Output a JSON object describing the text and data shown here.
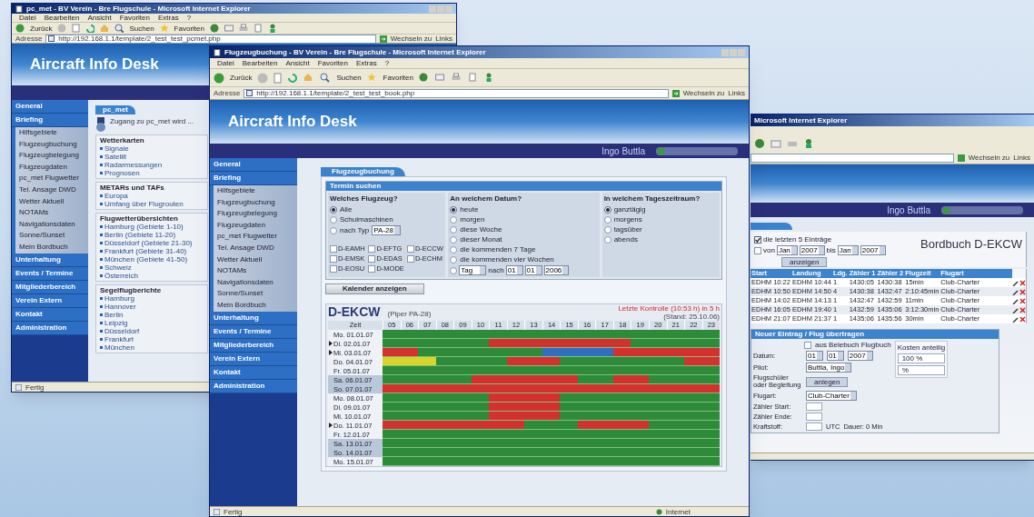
{
  "windows": [
    {
      "kind": "pcmet",
      "title": "pc_met - BV Verein - Bre Flugschule - Microsoft Internet Explorer",
      "menu": [
        "Datei",
        "Bearbeiten",
        "Ansicht",
        "Favoriten",
        "Extras",
        "?"
      ],
      "toolbar": [
        "Zurück",
        "Suchen",
        "Favoriten"
      ],
      "address_label": "Adresse",
      "url": "http://192.168.1.1/template/2_test_test_pcmet.php",
      "go_label": "Wechseln zu",
      "links_label": "Links",
      "site_title": "Aircraft Info Desk",
      "sidebar": [
        {
          "label": "General"
        },
        {
          "label": "Briefing",
          "children": [
            "Hilfsgebiete",
            "Flugzeugbuchung",
            "Flugzeugbelegung",
            "Flugzeugdaten",
            "pc_met Flugwetter",
            "Tel. Ansage DWD",
            "Wetter Aktuell",
            "NOTAMs",
            "Navigationsdaten",
            "Sonne/Sunset",
            "Mein Bordbuch"
          ]
        },
        {
          "label": "Unterhaltung"
        },
        {
          "label": "Events / Termine"
        },
        {
          "label": "Mitgliederbereich"
        },
        {
          "label": "Verein Extern"
        },
        {
          "label": "Kontakt"
        },
        {
          "label": "Administration"
        }
      ],
      "tab": "pc_met",
      "intro": "Zugang zu pc_met wird ...",
      "boxes": [
        {
          "title": "Wetterkarten",
          "items": [
            "Signale",
            "Satellit",
            "Radarmessungen",
            "Prognosen"
          ]
        },
        {
          "title": "METARs und TAFs",
          "items": [
            "Europa",
            "Umfang über Flugrouten"
          ]
        },
        {
          "title": "Flugwetterübersichten",
          "items": [
            "Hamburg (Gebiete 1-10)",
            "Berlin (Gebiete 11-20)",
            "Düsseldorf (Gebiete 21-30)",
            "Frankfurt (Gebiete 31-40)",
            "München (Gebiete 41-50)",
            "Schweiz",
            "Österreich"
          ]
        },
        {
          "title": "Segelflugberichte",
          "items": [
            "Hamburg",
            "Hannover",
            "Berlin",
            "Leipzig",
            "Düsseldorf",
            "Frankfurt",
            "München"
          ]
        }
      ],
      "status_bar": "Fertig"
    },
    {
      "kind": "bordbuch",
      "title": "Microsoft Internet Explorer",
      "go_label": "Wechseln zu",
      "links_label": "Links",
      "user_name": "Ingo Buttla",
      "heading": "Bordbuch D-EKCW",
      "filter_options": [
        {
          "label": "die letzten 5 Einträge",
          "selected": true
        },
        {
          "label": "von",
          "selected": false
        }
      ],
      "range": {
        "from_month": "Jan",
        "from_year": "2007",
        "to_word": "bis",
        "to_month": "Jan",
        "to_year": "2007"
      },
      "show_button": "anzeigen",
      "columns": [
        "Start",
        "Landung",
        "Ldg.",
        "Zähler 1",
        "Zähler 2",
        "Flugzeit",
        "Flugart"
      ],
      "rows": [
        [
          "EDHM 10:22",
          "EDHM 10:44",
          "1",
          "1430:05",
          "1430:38",
          "15min",
          "Club-Charter"
        ],
        [
          "EDHM 10:50",
          "EDHM 14:50",
          "4",
          "1430:38",
          "1432:47",
          "2:10:45min",
          "Club-Charter"
        ],
        [
          "EDHM 14:02",
          "EDHM 14:13",
          "1",
          "1432:47",
          "1432:59",
          "11min",
          "Club-Charter"
        ],
        [
          "EDHM 16:05",
          "EDHM 19:40",
          "1",
          "1432:59",
          "1435:06",
          "3:12:30min",
          "Club-Charter"
        ],
        [
          "EDHM 21:07",
          "EDHM 21:37",
          "1",
          "1435:06",
          "1435:56",
          "30min",
          "Club-Charter"
        ]
      ],
      "form_title": "Neuer Eintrag / Flug übertragen",
      "form_checkbox": {
        "label": "aus Belebuch Flugbuch",
        "checked": false
      },
      "form_rows": [
        {
          "label": "Datum:",
          "kind": "date",
          "values": [
            "01",
            "01",
            "2007"
          ]
        },
        {
          "label": "Pilot:",
          "kind": "select",
          "values": [
            "Buttla, Ingo"
          ]
        },
        {
          "label": "Flugschüler oder Begleitung",
          "kind": "button",
          "values": [
            "anlegen"
          ]
        },
        {
          "label": "Flugart:",
          "kind": "select",
          "values": [
            "Club-Charter"
          ]
        },
        {
          "label": "Zähler Start:",
          "kind": "input",
          "values": []
        },
        {
          "label": "Zähler Ende:",
          "kind": "input",
          "values": []
        },
        {
          "label": "Kraftstoff:",
          "kind": "input",
          "values": [
            "UTC",
            "Dauer: 0 Min"
          ]
        }
      ],
      "share_title": "Kosten anteilig",
      "share_values": [
        "100 %",
        "%"
      ]
    },
    {
      "kind": "booking",
      "title": "Flugzeugbuchung - BV Verein - Bre Flugschule - Microsoft Internet Explorer",
      "menu": [
        "Datei",
        "Bearbeiten",
        "Ansicht",
        "Favoriten",
        "Extras",
        "?"
      ],
      "toolbar": [
        "Zurück",
        "Suchen",
        "Favoriten"
      ],
      "address_label": "Adresse",
      "url": "http://192.168.1.1/template/2_test_test_book.php",
      "go_label": "Wechseln zu",
      "links_label": "Links",
      "site_title": "Aircraft Info Desk",
      "user_name": "Ingo Buttla",
      "sidebar": [
        {
          "label": "General"
        },
        {
          "label": "Briefing",
          "children": [
            "Hilfsgebiete",
            "Flugzeugbuchung",
            "Flugzeugbelegung",
            "Flugzeugdaten",
            "pc_met Flugwetter",
            "Tel. Ansage DWD",
            "Wetter Aktuell",
            "NOTAMs",
            "Navigationsdaten",
            "Sonne/Sunset",
            "Mein Bordbuch"
          ]
        },
        {
          "label": "Unterhaltung"
        },
        {
          "label": "Events / Termine"
        },
        {
          "label": "Mitgliederbereich"
        },
        {
          "label": "Verein Extern"
        },
        {
          "label": "Kontakt"
        },
        {
          "label": "Administration"
        }
      ],
      "tab": "Flugzeugbuchung",
      "search_title": "Termin suchen",
      "aircraft_group": {
        "title": "Welches Flugzeug?",
        "options": [
          {
            "label": "Alle",
            "selected": true
          },
          {
            "label": "Schulmaschinen",
            "selected": false
          },
          {
            "label": "nach Typ",
            "selected": false
          }
        ],
        "type_value": "PA-28",
        "planes": [
          {
            "label": "D-EAMH",
            "checked": false
          },
          {
            "label": "D-EFTG",
            "checked": false
          },
          {
            "label": "D-ECCW",
            "checked": false
          },
          {
            "label": "D-EMSK",
            "checked": false
          },
          {
            "label": "D-EDAS",
            "checked": false
          },
          {
            "label": "D-ECHM",
            "checked": false
          },
          {
            "label": "D-EOSU",
            "checked": false
          },
          {
            "label": "D-MODE",
            "checked": false
          }
        ]
      },
      "date_group": {
        "title": "An welchem Datum?",
        "options": [
          {
            "label": "heute",
            "selected": true
          },
          {
            "label": "morgen",
            "selected": false
          },
          {
            "label": "diese Woche",
            "selected": false
          },
          {
            "label": "dieser Monat",
            "selected": false
          },
          {
            "label": "die kommenden 7 Tage",
            "selected": false
          },
          {
            "label": "die kommenden vier Wochen",
            "selected": false
          }
        ],
        "custom": {
          "selected": false,
          "unit": "Tag",
          "word": "nach",
          "day": "01",
          "month": "01",
          "year": "2006"
        }
      },
      "time_group": {
        "title": "In welchem Tageszeitraum?",
        "options": [
          {
            "label": "ganztägig",
            "selected": true
          },
          {
            "label": "morgens",
            "selected": false
          },
          {
            "label": "tagsüber",
            "selected": false
          },
          {
            "label": "abends",
            "selected": false
          }
        ]
      },
      "show_button": "Kalender anzeigen",
      "calendar": {
        "aircraft": "D-EKCW",
        "type": "(Piper PA-28)",
        "note": "Letzte Kontrolle (10:53 h) in 5 h",
        "stand": "(Stand: 25.10.06)",
        "time_header": "Zeit",
        "hours": [
          "05",
          "06",
          "07",
          "08",
          "09",
          "10",
          "11",
          "12",
          "13",
          "14",
          "15",
          "16",
          "17",
          "18",
          "19",
          "20",
          "21",
          "22",
          "23"
        ],
        "rows": [
          {
            "date": "Mo. 01.01.07",
            "marked": false,
            "weekend": false,
            "slots": [
              {
                "kind": "free"
              },
              {
                "kind": "free"
              },
              {
                "kind": "free"
              },
              {
                "kind": "free"
              },
              {
                "kind": "free"
              },
              {
                "kind": "free"
              },
              {
                "kind": "free"
              },
              {
                "kind": "free"
              },
              {
                "kind": "free"
              },
              {
                "kind": "free"
              },
              {
                "kind": "free"
              },
              {
                "kind": "free"
              },
              {
                "kind": "free"
              },
              {
                "kind": "free"
              },
              {
                "kind": "free"
              },
              {
                "kind": "free"
              },
              {
                "kind": "free"
              },
              {
                "kind": "free"
              },
              {
                "kind": "free"
              }
            ]
          },
          {
            "date": "Di. 02.01.07",
            "marked": true,
            "weekend": false,
            "slots": [
              {
                "kind": "free"
              },
              {
                "kind": "free"
              },
              {
                "kind": "free"
              },
              {
                "kind": "free"
              },
              {
                "kind": "free"
              },
              {
                "kind": "free"
              },
              {
                "kind": "booked"
              },
              {
                "kind": "booked"
              },
              {
                "kind": "booked"
              },
              {
                "kind": "booked"
              },
              {
                "kind": "booked"
              },
              {
                "kind": "booked"
              },
              {
                "kind": "booked"
              },
              {
                "kind": "booked"
              },
              {
                "kind": "free"
              },
              {
                "kind": "free"
              },
              {
                "kind": "free"
              },
              {
                "kind": "free"
              },
              {
                "kind": "free"
              }
            ]
          },
          {
            "date": "Mi. 03.01.07",
            "marked": true,
            "weekend": false,
            "slots": [
              {
                "kind": "booked"
              },
              {
                "kind": "booked"
              },
              {
                "kind": "free"
              },
              {
                "kind": "free"
              },
              {
                "kind": "free"
              },
              {
                "kind": "free"
              },
              {
                "kind": "free"
              },
              {
                "kind": "free"
              },
              {
                "kind": "free"
              },
              {
                "kind": "own"
              },
              {
                "kind": "own"
              },
              {
                "kind": "own"
              },
              {
                "kind": "own"
              },
              {
                "kind": "booked"
              },
              {
                "kind": "booked"
              },
              {
                "kind": "booked"
              },
              {
                "kind": "booked"
              },
              {
                "kind": "booked"
              },
              {
                "kind": "booked"
              }
            ]
          },
          {
            "date": "Do. 04.01.07",
            "marked": false,
            "weekend": false,
            "slots": [
              {
                "kind": "pending"
              },
              {
                "kind": "pending"
              },
              {
                "kind": "pending"
              },
              {
                "kind": "free"
              },
              {
                "kind": "free"
              },
              {
                "kind": "free"
              },
              {
                "kind": "free"
              },
              {
                "kind": "booked"
              },
              {
                "kind": "booked"
              },
              {
                "kind": "booked"
              },
              {
                "kind": "free"
              },
              {
                "kind": "free"
              },
              {
                "kind": "free"
              },
              {
                "kind": "free"
              },
              {
                "kind": "free"
              },
              {
                "kind": "free"
              },
              {
                "kind": "free"
              },
              {
                "kind": "booked"
              },
              {
                "kind": "booked"
              }
            ]
          },
          {
            "date": "Fr. 05.01.07",
            "marked": false,
            "weekend": false,
            "slots": [
              {
                "kind": "free"
              },
              {
                "kind": "free"
              },
              {
                "kind": "free"
              },
              {
                "kind": "free"
              },
              {
                "kind": "free"
              },
              {
                "kind": "free"
              },
              {
                "kind": "free"
              },
              {
                "kind": "free"
              },
              {
                "kind": "free"
              },
              {
                "kind": "free"
              },
              {
                "kind": "free"
              },
              {
                "kind": "free"
              },
              {
                "kind": "free"
              },
              {
                "kind": "free"
              },
              {
                "kind": "free"
              },
              {
                "kind": "free"
              },
              {
                "kind": "free"
              },
              {
                "kind": "free"
              },
              {
                "kind": "free"
              }
            ]
          },
          {
            "date": "Sa. 06.01.07",
            "marked": false,
            "weekend": true,
            "slots": [
              {
                "kind": "free"
              },
              {
                "kind": "free"
              },
              {
                "kind": "free"
              },
              {
                "kind": "free"
              },
              {
                "kind": "free"
              },
              {
                "kind": "booked"
              },
              {
                "kind": "booked"
              },
              {
                "kind": "booked"
              },
              {
                "kind": "booked"
              },
              {
                "kind": "booked"
              },
              {
                "kind": "booked"
              },
              {
                "kind": "free"
              },
              {
                "kind": "free"
              },
              {
                "kind": "booked"
              },
              {
                "kind": "booked"
              },
              {
                "kind": "free"
              },
              {
                "kind": "free"
              },
              {
                "kind": "free"
              },
              {
                "kind": "free"
              }
            ]
          },
          {
            "date": "So. 07.01.07",
            "marked": false,
            "weekend": true,
            "slots": [
              {
                "kind": "booked"
              },
              {
                "kind": "booked"
              },
              {
                "kind": "booked"
              },
              {
                "kind": "booked"
              },
              {
                "kind": "booked"
              },
              {
                "kind": "booked"
              },
              {
                "kind": "booked"
              },
              {
                "kind": "booked"
              },
              {
                "kind": "booked"
              },
              {
                "kind": "booked"
              },
              {
                "kind": "booked"
              },
              {
                "kind": "booked"
              },
              {
                "kind": "booked"
              },
              {
                "kind": "booked"
              },
              {
                "kind": "booked"
              },
              {
                "kind": "booked"
              },
              {
                "kind": "booked"
              },
              {
                "kind": "booked"
              },
              {
                "kind": "booked"
              }
            ]
          },
          {
            "date": "Mo. 08.01.07",
            "marked": false,
            "weekend": false,
            "slots": [
              {
                "kind": "free"
              },
              {
                "kind": "free"
              },
              {
                "kind": "free"
              },
              {
                "kind": "free"
              },
              {
                "kind": "free"
              },
              {
                "kind": "free"
              },
              {
                "kind": "booked"
              },
              {
                "kind": "booked"
              },
              {
                "kind": "booked"
              },
              {
                "kind": "booked"
              },
              {
                "kind": "free"
              },
              {
                "kind": "free"
              },
              {
                "kind": "free"
              },
              {
                "kind": "free"
              },
              {
                "kind": "free"
              },
              {
                "kind": "free"
              },
              {
                "kind": "free"
              },
              {
                "kind": "free"
              },
              {
                "kind": "free"
              }
            ]
          },
          {
            "date": "Di. 09.01.07",
            "marked": false,
            "weekend": false,
            "slots": [
              {
                "kind": "free"
              },
              {
                "kind": "free"
              },
              {
                "kind": "free"
              },
              {
                "kind": "free"
              },
              {
                "kind": "free"
              },
              {
                "kind": "free"
              },
              {
                "kind": "booked"
              },
              {
                "kind": "booked"
              },
              {
                "kind": "booked"
              },
              {
                "kind": "booked"
              },
              {
                "kind": "free"
              },
              {
                "kind": "free"
              },
              {
                "kind": "free"
              },
              {
                "kind": "free"
              },
              {
                "kind": "free"
              },
              {
                "kind": "free"
              },
              {
                "kind": "free"
              },
              {
                "kind": "free"
              },
              {
                "kind": "free"
              }
            ]
          },
          {
            "date": "Mi. 10.01.07",
            "marked": false,
            "weekend": false,
            "slots": [
              {
                "kind": "free"
              },
              {
                "kind": "free"
              },
              {
                "kind": "free"
              },
              {
                "kind": "free"
              },
              {
                "kind": "free"
              },
              {
                "kind": "free"
              },
              {
                "kind": "booked"
              },
              {
                "kind": "booked"
              },
              {
                "kind": "booked"
              },
              {
                "kind": "booked"
              },
              {
                "kind": "free"
              },
              {
                "kind": "free"
              },
              {
                "kind": "free"
              },
              {
                "kind": "free"
              },
              {
                "kind": "free"
              },
              {
                "kind": "free"
              },
              {
                "kind": "free"
              },
              {
                "kind": "free"
              },
              {
                "kind": "free"
              }
            ]
          },
          {
            "date": "Do. 11.01.07",
            "marked": true,
            "weekend": false,
            "slots": [
              {
                "kind": "booked"
              },
              {
                "kind": "booked"
              },
              {
                "kind": "booked"
              },
              {
                "kind": "booked"
              },
              {
                "kind": "booked"
              },
              {
                "kind": "booked"
              },
              {
                "kind": "booked"
              },
              {
                "kind": "booked"
              },
              {
                "kind": "free"
              },
              {
                "kind": "free"
              },
              {
                "kind": "free"
              },
              {
                "kind": "booked"
              },
              {
                "kind": "booked"
              },
              {
                "kind": "booked"
              },
              {
                "kind": "booked"
              },
              {
                "kind": "free"
              },
              {
                "kind": "free"
              },
              {
                "kind": "free"
              },
              {
                "kind": "free"
              }
            ]
          },
          {
            "date": "Fr. 12.01.07",
            "marked": false,
            "weekend": false,
            "slots": [
              {
                "kind": "free"
              },
              {
                "kind": "free"
              },
              {
                "kind": "free"
              },
              {
                "kind": "free"
              },
              {
                "kind": "free"
              },
              {
                "kind": "free"
              },
              {
                "kind": "free"
              },
              {
                "kind": "free"
              },
              {
                "kind": "free"
              },
              {
                "kind": "free"
              },
              {
                "kind": "free"
              },
              {
                "kind": "free"
              },
              {
                "kind": "free"
              },
              {
                "kind": "free"
              },
              {
                "kind": "free"
              },
              {
                "kind": "free"
              },
              {
                "kind": "free"
              },
              {
                "kind": "free"
              },
              {
                "kind": "free"
              }
            ]
          },
          {
            "date": "Sa. 13.01.07",
            "marked": false,
            "weekend": true,
            "slots": [
              {
                "kind": "free"
              },
              {
                "kind": "free"
              },
              {
                "kind": "free"
              },
              {
                "kind": "free"
              },
              {
                "kind": "free"
              },
              {
                "kind": "free"
              },
              {
                "kind": "free"
              },
              {
                "kind": "free"
              },
              {
                "kind": "free"
              },
              {
                "kind": "free"
              },
              {
                "kind": "free"
              },
              {
                "kind": "free"
              },
              {
                "kind": "free"
              },
              {
                "kind": "free"
              },
              {
                "kind": "free"
              },
              {
                "kind": "free"
              },
              {
                "kind": "free"
              },
              {
                "kind": "free"
              },
              {
                "kind": "free"
              }
            ]
          },
          {
            "date": "So. 14.01.07",
            "marked": false,
            "weekend": true,
            "slots": [
              {
                "kind": "free"
              },
              {
                "kind": "free"
              },
              {
                "kind": "free"
              },
              {
                "kind": "free"
              },
              {
                "kind": "free"
              },
              {
                "kind": "free"
              },
              {
                "kind": "free"
              },
              {
                "kind": "free"
              },
              {
                "kind": "free"
              },
              {
                "kind": "free"
              },
              {
                "kind": "free"
              },
              {
                "kind": "free"
              },
              {
                "kind": "free"
              },
              {
                "kind": "free"
              },
              {
                "kind": "free"
              },
              {
                "kind": "free"
              },
              {
                "kind": "free"
              },
              {
                "kind": "free"
              },
              {
                "kind": "free"
              }
            ]
          },
          {
            "date": "Mo. 15.01.07",
            "marked": false,
            "weekend": false,
            "slots": [
              {
                "kind": "free"
              },
              {
                "kind": "free"
              },
              {
                "kind": "free"
              },
              {
                "kind": "free"
              },
              {
                "kind": "free"
              },
              {
                "kind": "free"
              },
              {
                "kind": "free"
              },
              {
                "kind": "free"
              },
              {
                "kind": "free"
              },
              {
                "kind": "free"
              },
              {
                "kind": "free"
              },
              {
                "kind": "free"
              },
              {
                "kind": "free"
              },
              {
                "kind": "free"
              },
              {
                "kind": "free"
              },
              {
                "kind": "free"
              },
              {
                "kind": "free"
              },
              {
                "kind": "free"
              },
              {
                "kind": "free"
              }
            ]
          }
        ]
      },
      "status_bar": "Fertig",
      "zone": "Internet"
    }
  ]
}
